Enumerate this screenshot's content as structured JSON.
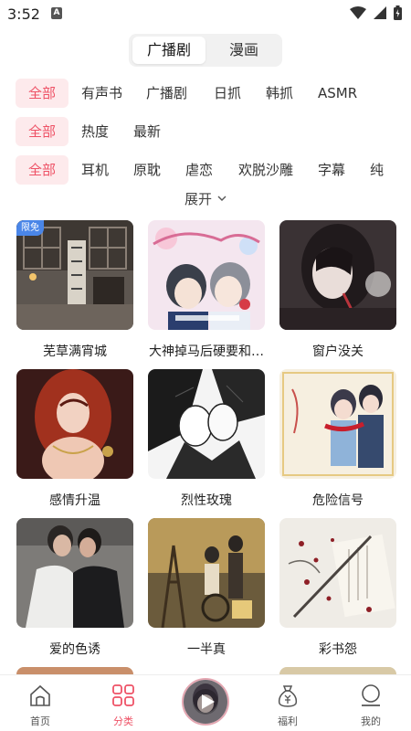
{
  "status": {
    "time": "3:52"
  },
  "top_toggle": {
    "tabs": [
      {
        "label": "广播剧",
        "active": true
      },
      {
        "label": "漫画",
        "active": false
      }
    ]
  },
  "filters": {
    "row1": [
      "全部",
      "有声书",
      "广播剧",
      "日抓",
      "韩抓",
      "ASMR"
    ],
    "row2": [
      "全部",
      "热度",
      "最新"
    ],
    "row3": [
      "全部",
      "耳机",
      "原耽",
      "虐恋",
      "欢脱沙雕",
      "字幕",
      "纯"
    ],
    "expand_label": "展开"
  },
  "grid": {
    "items": [
      {
        "title": "芜草满宵城",
        "badge": "限免",
        "cover_icon": "classical-room-cover"
      },
      {
        "title": "大神掉马后硬要和…",
        "cover_icon": "two-boys-anime-cover"
      },
      {
        "title": "窗户没关",
        "cover_icon": "dark-portrait-cover"
      },
      {
        "title": "感情升温",
        "cover_icon": "red-hair-girl-cover"
      },
      {
        "title": "烈性玫瑰",
        "cover_icon": "manga-sketch-cover"
      },
      {
        "title": "危险信号",
        "cover_icon": "couple-red-scarf-cover"
      },
      {
        "title": "爱的色诱",
        "cover_icon": "two-men-embrace-cover"
      },
      {
        "title": "一半真",
        "cover_icon": "stage-ruins-cover"
      },
      {
        "title": "彩书怨",
        "cover_icon": "sword-flowers-cover"
      }
    ]
  },
  "bottom_nav": {
    "items": [
      {
        "label": "首页",
        "icon": "home-icon",
        "active": false
      },
      {
        "label": "分类",
        "icon": "category-grid-icon",
        "active": true
      },
      {
        "label": "福利",
        "icon": "money-bag-icon",
        "active": false
      },
      {
        "label": "我的",
        "icon": "profile-icon",
        "active": false
      }
    ],
    "player": {
      "icon": "play-icon"
    }
  },
  "colors": {
    "accent": "#ee5266",
    "chip_bg": "#fdeaec",
    "badge": "#4a86e8"
  }
}
